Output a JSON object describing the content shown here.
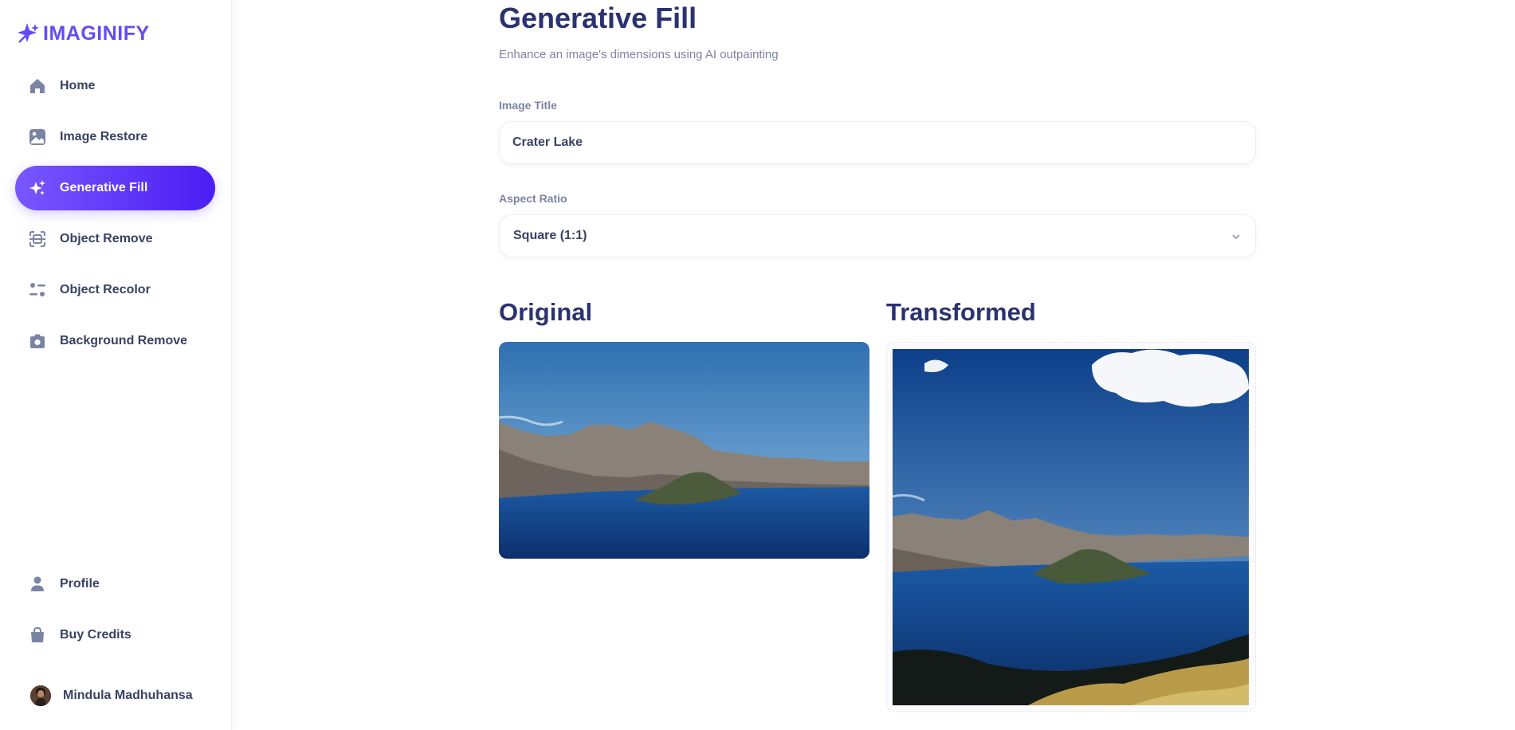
{
  "app": {
    "logo_text": "IMAGINIFY",
    "brand_color": "#624cf5",
    "accent_gradient": [
      "#7857ff",
      "#4b1df3"
    ]
  },
  "sidebar": {
    "items": [
      {
        "label": "Home",
        "icon": "home-icon",
        "active": false
      },
      {
        "label": "Image Restore",
        "icon": "image-icon",
        "active": false
      },
      {
        "label": "Generative Fill",
        "icon": "stars-icon",
        "active": true
      },
      {
        "label": "Object Remove",
        "icon": "scan-icon",
        "active": false
      },
      {
        "label": "Object Recolor",
        "icon": "filter-icon",
        "active": false
      },
      {
        "label": "Background Remove",
        "icon": "camera-icon",
        "active": false
      }
    ],
    "bottom_items": [
      {
        "label": "Profile",
        "icon": "user-icon"
      },
      {
        "label": "Buy Credits",
        "icon": "bag-icon"
      }
    ],
    "user": {
      "name": "Mindula Madhuhansa"
    }
  },
  "main": {
    "title": "Generative Fill",
    "subtitle": "Enhance an image's dimensions using AI outpainting",
    "image_title": {
      "label": "Image Title",
      "value": "Crater Lake"
    },
    "aspect_ratio": {
      "label": "Aspect Ratio",
      "value": "Square (1:1)"
    },
    "original_heading": "Original",
    "transformed_heading": "Transformed"
  }
}
